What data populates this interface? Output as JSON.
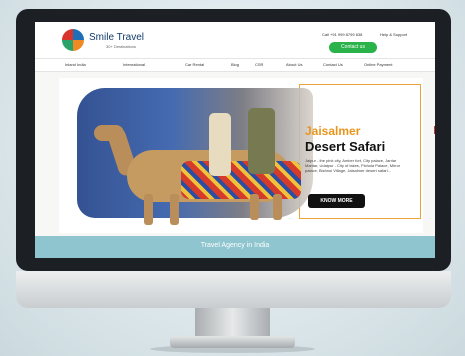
{
  "brand": {
    "name": "Smile Travel",
    "tagline": "30+ Destinations"
  },
  "header": {
    "phone": "Call +91 999 8799 638",
    "help": "Help & Support",
    "contact_button": "Contact us"
  },
  "nav": {
    "items": [
      "Inland India",
      "International",
      "Car Rental",
      "Blog",
      "CSR",
      "About Us",
      "Contact Us",
      "Online Payment"
    ]
  },
  "hero": {
    "title_line1": "Jaisalmer",
    "title_line2": "Desert Safari",
    "description": "Jaipur - the pink city, Amber fort, City palace, Jantar Mantar, Udaipur - City of lakes, Pichola Palace, Mirror palace, Bishnoi Village, Jaisalmer desert safari...",
    "button": "KNOW MORE"
  },
  "footer": {
    "banner": "Travel Agency in India"
  },
  "colors": {
    "accent": "#e8951e",
    "button_green": "#29b34a",
    "band": "#8ec5cf",
    "navy": "#123b6b"
  },
  "icons": [
    "logo-icon",
    "chevron-down-icon"
  ]
}
